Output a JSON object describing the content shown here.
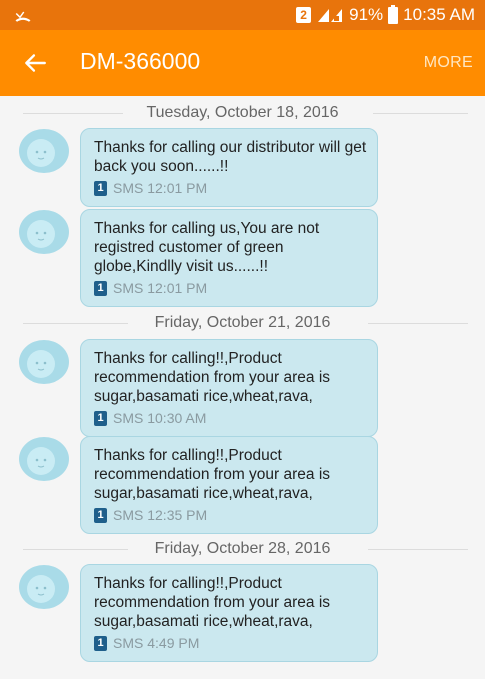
{
  "status_bar": {
    "sim_slot": "2",
    "battery": "91%",
    "time": "10:35 AM"
  },
  "app_bar": {
    "title": "DM-366000",
    "more_label": "MORE"
  },
  "conversation": {
    "dates": [
      "Tuesday, October 18, 2016",
      "Friday, October 21, 2016",
      "Friday, October 28, 2016"
    ],
    "messages": [
      {
        "text": "Thanks for calling our distributor will get back you soon......!!",
        "sim": "1",
        "meta": "SMS 12:01 PM"
      },
      {
        "text": "Thanks for calling us,You are not registred customer of green globe,Kindlly visit us......!!",
        "sim": "1",
        "meta": "SMS 12:01 PM"
      },
      {
        "text": "Thanks for calling!!,Product recommendation from your area is sugar,basamati rice,wheat,rava,",
        "sim": "1",
        "meta": "SMS 10:30 AM"
      },
      {
        "text": "Thanks for calling!!,Product recommendation from your area is sugar,basamati rice,wheat,rava,",
        "sim": "1",
        "meta": "SMS 12:35 PM"
      },
      {
        "text": "Thanks for calling!!,Product recommendation from your area is sugar,basamati rice,wheat,rava,",
        "sim": "1",
        "meta": "SMS 4:49 PM"
      }
    ]
  },
  "colors": {
    "status_bar": "#e8740c",
    "app_bar": "#ff8c00",
    "bubble": "#cbe8ef",
    "sim_badge": "#1f5f8b"
  },
  "icons": {
    "status_left": "missed-call-icon",
    "back": "back-arrow-icon",
    "avatar": "contact-avatar-icon",
    "sim": "sim-1-icon"
  }
}
